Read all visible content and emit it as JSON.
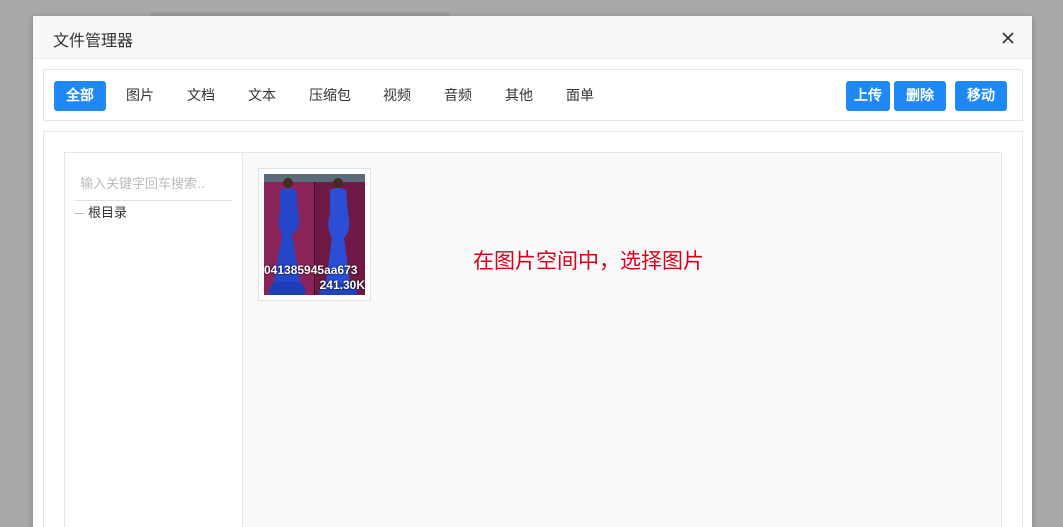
{
  "dialog": {
    "title": "文件管理器"
  },
  "toolbar": {
    "tabs": [
      {
        "label": "全部",
        "active": true
      },
      {
        "label": "图片"
      },
      {
        "label": "文档"
      },
      {
        "label": "文本"
      },
      {
        "label": "压缩包"
      },
      {
        "label": "视频"
      },
      {
        "label": "音频"
      },
      {
        "label": "其他"
      },
      {
        "label": "面单"
      }
    ],
    "upload_label": "上传",
    "delete_label": "删除",
    "move_label": "移动"
  },
  "sidebar": {
    "search_placeholder": "输入关键字回车搜索..",
    "root_label": "根目录"
  },
  "files": [
    {
      "name": "041385945aa673",
      "size": "241.30K",
      "icon": "image-thumbnail"
    }
  ],
  "annotation": "在图片空间中，选择图片",
  "colors": {
    "accent": "#1e88f5",
    "annotation": "#d9001b"
  }
}
